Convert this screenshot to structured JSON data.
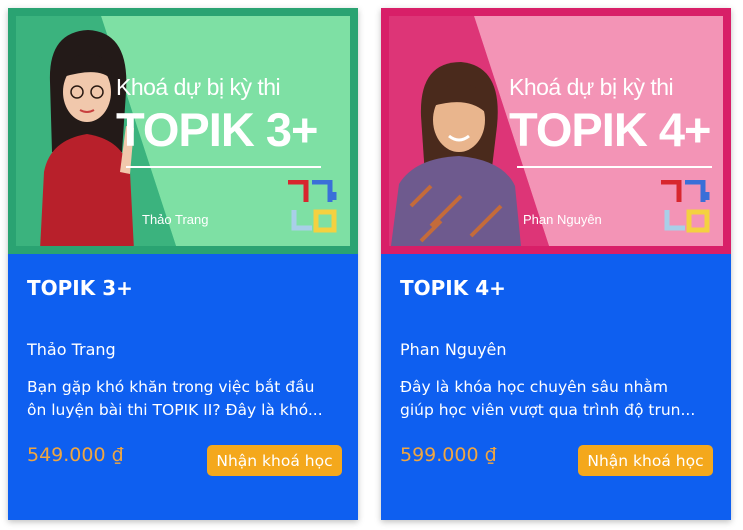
{
  "courses": [
    {
      "banner_subtitle": "Khoá dự bị kỳ thi",
      "banner_title": "TOPIK 3+",
      "banner_teacher": "Thảo Trang",
      "title": "TOPIK 3+",
      "teacher": "Thảo Trang",
      "desc_line1": "Bạn gặp khó khăn trong việc bắt đầu",
      "desc_line2": "ôn luyện bài thi TOPIK II? Đây là khó...",
      "price": "549.000 ₫",
      "button": "Nhận khoá học",
      "accent": "#2aa372"
    },
    {
      "banner_subtitle": "Khoá dự bị kỳ thi",
      "banner_title": "TOPIK 4+",
      "banner_teacher": "Phan Nguyên",
      "title": "TOPIK 4+",
      "teacher": "Phan Nguyên",
      "desc_line1": "Đây là khóa học chuyên sâu nhằm",
      "desc_line2": "giúp học viên vượt qua trình độ trun...",
      "price": "599.000 ₫",
      "button": "Nhận khoá học",
      "accent": "#d81f68"
    }
  ],
  "colors": {
    "card_bg": "#0e5ff0",
    "price": "#f0a640",
    "button_bg": "#f4a81c"
  },
  "icons": [
    "person-photo",
    "hangul-logo"
  ]
}
